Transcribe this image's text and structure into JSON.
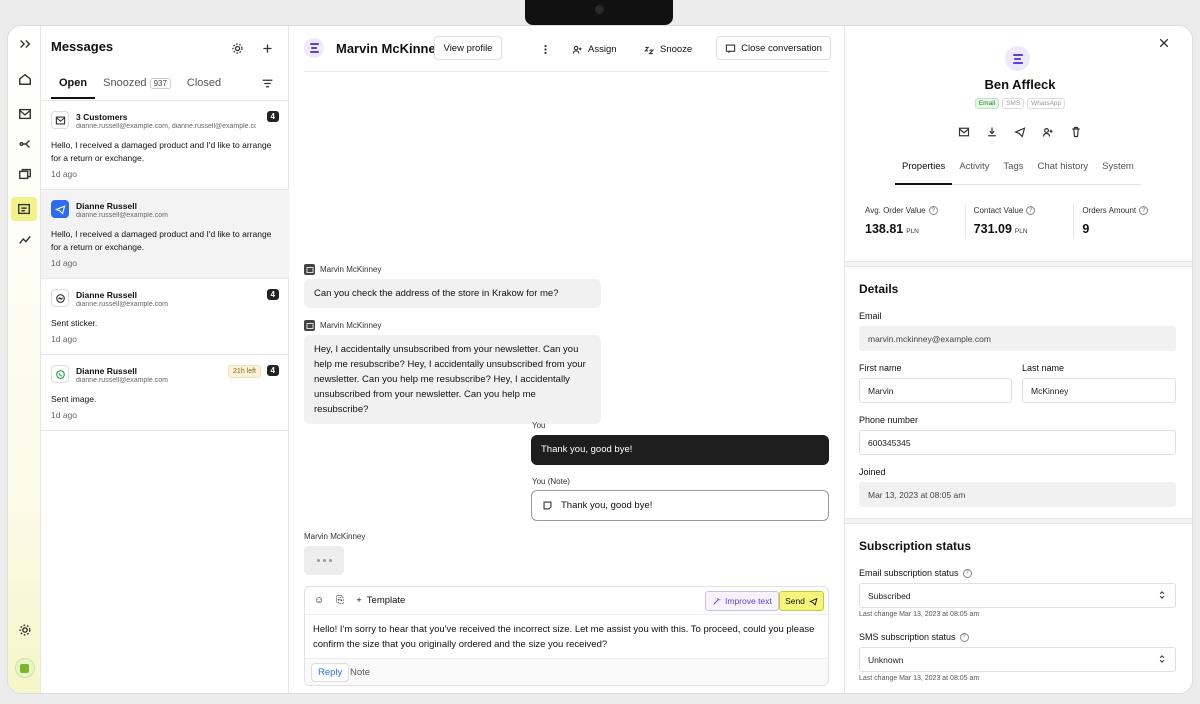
{
  "inbox": {
    "title": "Messages",
    "tabs": [
      {
        "label": "Open"
      },
      {
        "label": "Snoozed",
        "count": "937"
      },
      {
        "label": "Closed"
      }
    ],
    "conversations": [
      {
        "name": "3 Customers",
        "email": "dianne.russell@example.com, dianne.russell@example.co...",
        "message": "Hello, I received a damaged product and I'd like to arrange for a return or exchange.",
        "ago": "1d ago",
        "badge": "4",
        "icon": "mail-icon"
      },
      {
        "name": "Dianne Russell",
        "email": "dianne.russell@example.com",
        "message": "Hello, I received a damaged product and I'd like to arrange for a return or exchange.",
        "ago": "1d ago",
        "icon": "telegram-icon"
      },
      {
        "name": "Dianne Russell",
        "email": "dianne.russell@example.com",
        "message": "Sent sticker.",
        "ago": "1d ago",
        "badge": "4",
        "icon": "messenger-icon"
      },
      {
        "name": "Dianne Russell",
        "email": "dianne.russell@example.com",
        "message": "Sent image.",
        "ago": "1d ago",
        "badge": "4",
        "time_left": "21h left",
        "icon": "whatsapp-icon"
      }
    ]
  },
  "chat": {
    "contact_name": "Marvin McKinney",
    "view_profile": "View profile",
    "assign": "Assign",
    "snooze": "Snooze",
    "close_conversation": "Close conversation",
    "messages": [
      {
        "sender": "Marvin McKinney",
        "text": "Can you check the address of the store in Krakow for me?"
      },
      {
        "sender": "Marvin McKinney",
        "text": "Hey, I accidentally unsubscribed from your newsletter. Can you help me resubscribe? Hey, I accidentally unsubscribed from your newsletter. Can you help me resubscribe? Hey, I accidentally unsubscribed from your newsletter. Can you help me resubscribe?"
      },
      {
        "sender": "You",
        "text": "Thank you, good bye!"
      },
      {
        "sender": "You (Note)",
        "text": "Thank you, good bye!"
      }
    ],
    "typing_sender": "Marvin McKinney",
    "composer": {
      "template": "Template",
      "improve": "Improve text",
      "send": "Send",
      "text": "Hello! I'm sorry to hear that you've received the incorrect size. Let me assist you with this. To proceed, could you please confirm the size that you originally ordered and the size you received?",
      "reply_tab": "Reply",
      "note_tab": "Note"
    }
  },
  "profile": {
    "name": "Ben Affleck",
    "channels": [
      {
        "label": "Email",
        "active": true
      },
      {
        "label": "SMS",
        "active": false
      },
      {
        "label": "WhatsApp",
        "active": false
      }
    ],
    "tabs": [
      "Properties",
      "Activity",
      "Tags",
      "Chat history",
      "System"
    ],
    "stats": [
      {
        "label": "Avg. Order Value",
        "value": "138.81",
        "unit": "PLN"
      },
      {
        "label": "Contact Value",
        "value": "731.09",
        "unit": "PLN"
      },
      {
        "label": "Orders Amount",
        "value": "9",
        "unit": ""
      }
    ],
    "details": {
      "title": "Details",
      "email_label": "Email",
      "email": "marvin.mckinney@example.com",
      "first_name_label": "First name",
      "first_name": "Marvin",
      "last_name_label": "Last name",
      "last_name": "McKinney",
      "phone_label": "Phone number",
      "phone": "600345345",
      "joined_label": "Joined",
      "joined": "Mar 13, 2023 at 08:05 am"
    },
    "subscription": {
      "title": "Subscription status",
      "email_label": "Email subscription status",
      "email_value": "Subscribed",
      "email_change": "Last change Mar 13, 2023 at 08:05 am",
      "sms_label": "SMS subscription status",
      "sms_value": "Unknown",
      "sms_change": "Last change Mar 13, 2023 at 08:05 am"
    }
  },
  "colors": {
    "accent": "#f5f57a",
    "brand": "#5b3fd9",
    "link": "#2d6cf0"
  }
}
